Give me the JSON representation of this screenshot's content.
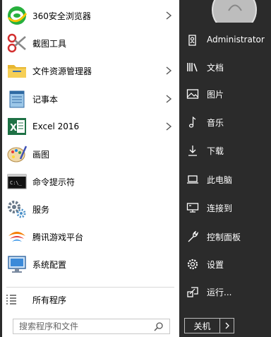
{
  "programs": [
    {
      "label": "360安全浏览器",
      "icon": "browser-360-icon",
      "has_arrow": true
    },
    {
      "label": "截图工具",
      "icon": "scissors-icon",
      "has_arrow": false
    },
    {
      "label": "文件资源管理器",
      "icon": "folder-icon",
      "has_arrow": true
    },
    {
      "label": "记事本",
      "icon": "notepad-icon",
      "has_arrow": true
    },
    {
      "label": "Excel 2016",
      "icon": "excel-icon",
      "has_arrow": true
    },
    {
      "label": "画图",
      "icon": "paint-palette-icon",
      "has_arrow": false
    },
    {
      "label": "命令提示符",
      "icon": "cmd-icon",
      "has_arrow": false
    },
    {
      "label": "服务",
      "icon": "gears-icon",
      "has_arrow": false
    },
    {
      "label": "腾讯游戏平台",
      "icon": "tencent-games-icon",
      "has_arrow": false
    },
    {
      "label": "系统配置",
      "icon": "system-config-icon",
      "has_arrow": false
    }
  ],
  "all_programs": {
    "label": "所有程序",
    "icon": "list-icon"
  },
  "search": {
    "placeholder": "搜索程序和文件",
    "icon": "search-icon"
  },
  "side": {
    "user": {
      "label": "Administrator",
      "icon": "user-icon"
    },
    "items": [
      {
        "label": "文档",
        "icon": "library-icon"
      },
      {
        "label": "图片",
        "icon": "picture-icon"
      },
      {
        "label": "音乐",
        "icon": "music-note-icon"
      },
      {
        "label": "下载",
        "icon": "download-icon"
      },
      {
        "label": "此电脑",
        "icon": "laptop-icon"
      },
      {
        "label": "连接到",
        "icon": "network-icon"
      },
      {
        "label": "控制面板",
        "icon": "wrench-icon"
      },
      {
        "label": "设置",
        "icon": "gear-icon"
      },
      {
        "label": "运行...",
        "icon": "run-icon"
      }
    ]
  },
  "power": {
    "label": "关机",
    "icon": "chevron-right-icon"
  },
  "colors": {
    "left_bg": "#ffffff",
    "right_bg": "#2b2b2b",
    "text_dark": "#000000",
    "text_light": "#ffffff"
  }
}
